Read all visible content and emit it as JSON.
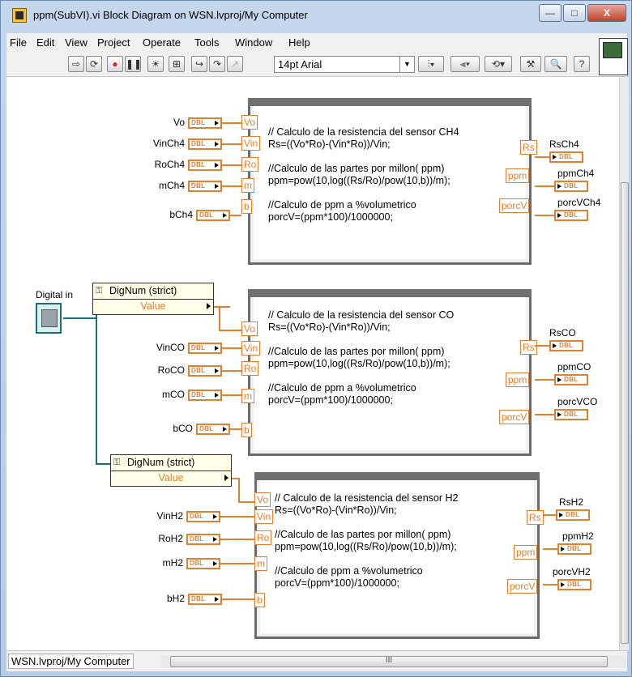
{
  "window": {
    "title": "ppm(SubVI).vi Block Diagram on WSN.lvproj/My Computer",
    "min_label": "—",
    "max_label": "□",
    "close_label": "X"
  },
  "menu": [
    "File",
    "Edit",
    "View",
    "Project",
    "Operate",
    "Tools",
    "Window",
    "Help"
  ],
  "toolbar": {
    "font_value": "14pt Arial"
  },
  "statusbar": {
    "context": "WSN.lvproj/My Computer",
    "scroll_grip": "III"
  },
  "digital_in": {
    "label": "Digital in"
  },
  "property_nodes": [
    {
      "head": "DigNum (strict)",
      "value": "Value"
    },
    {
      "head": "DigNum (strict)",
      "value": "Value"
    }
  ],
  "dbl_text": "DBL",
  "nodes": [
    {
      "code": "// Calculo de la resistencia del sensor CH4\nRs=((Vo*Ro)-(Vin*Ro))/Vin;\n\n//Calculo de las partes por millon( ppm)\nppm=pow(10,log((Rs/Ro)/pow(10,b))/m);\n\n//Calculo de ppm a %volumetrico\nporcV=(ppm*100)/1000000;",
      "in_terms": [
        "Vo",
        "Vin",
        "Ro",
        "m",
        "b"
      ],
      "out_terms": [
        "Rs",
        "ppm",
        "porcV"
      ],
      "inputs": [
        "Vo",
        "VinCh4",
        "RoCh4",
        "mCh4",
        "bCh4"
      ],
      "outputs": [
        "RsCh4",
        "ppmCh4",
        "porcVCh4"
      ]
    },
    {
      "code": "// Calculo de la resistencia del sensor CO\nRs=((Vo*Ro)-(Vin*Ro))/Vin;\n\n//Calculo de las partes por millon( ppm)\nppm=pow(10,log((Rs/Ro)/pow(10,b))/m);\n\n//Calculo de ppm a %volumetrico\nporcV=(ppm*100)/1000000;",
      "in_terms": [
        "Vo",
        "Vin",
        "Ro",
        "m",
        "b"
      ],
      "out_terms": [
        "Rs",
        "ppm",
        "porcV"
      ],
      "inputs": [
        "VinCO",
        "RoCO",
        "mCO",
        "bCO"
      ],
      "outputs": [
        "RsCO",
        "ppmCO",
        "porcVCO"
      ]
    },
    {
      "code": "// Calculo de la resistencia del sensor H2\nRs=((Vo*Ro)-(Vin*Ro))/Vin;\n\n//Calculo de las partes por millon( ppm)\nppm=pow(10,log((Rs/Ro)/pow(10,b))/m);\n\n//Calculo de ppm a %volumetrico\nporcV=(ppm*100)/1000000;",
      "in_terms": [
        "Vo",
        "Vin",
        "Ro",
        "m",
        "b"
      ],
      "out_terms": [
        "Rs",
        "ppm",
        "porcV"
      ],
      "inputs": [
        "VinH2",
        "RoH2",
        "mH2",
        "bH2"
      ],
      "outputs": [
        "RsH2",
        "ppmH2",
        "porcVH2"
      ]
    }
  ]
}
